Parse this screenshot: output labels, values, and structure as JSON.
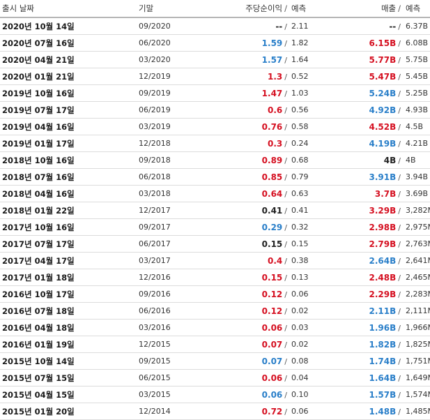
{
  "colors": {
    "positive": "#2a7fc9",
    "negative": "#d51021",
    "neutral": "#222222"
  },
  "header": {
    "date": "출시 날짜",
    "period": "기말",
    "eps": "주당순이익",
    "eps_slash": "/",
    "eps_forecast": "예측",
    "revenue": "매출",
    "revenue_slash": "/",
    "revenue_forecast": "예측"
  },
  "rows": [
    {
      "date": "2020년 10월 14일",
      "period": "09/2020",
      "eps": "--",
      "eps_dir": "neu",
      "eps_forecast": "2.11",
      "revenue": "--",
      "rev_dir": "neu",
      "revenue_forecast": "6.37B"
    },
    {
      "date": "2020년 07월 16일",
      "period": "06/2020",
      "eps": "1.59",
      "eps_dir": "pos",
      "eps_forecast": "1.82",
      "revenue": "6.15B",
      "rev_dir": "neg",
      "revenue_forecast": "6.08B"
    },
    {
      "date": "2020년 04월 21일",
      "period": "03/2020",
      "eps": "1.57",
      "eps_dir": "pos",
      "eps_forecast": "1.64",
      "revenue": "5.77B",
      "rev_dir": "neg",
      "revenue_forecast": "5.75B"
    },
    {
      "date": "2020년 01월 21일",
      "period": "12/2019",
      "eps": "1.3",
      "eps_dir": "neg",
      "eps_forecast": "0.52",
      "revenue": "5.47B",
      "rev_dir": "neg",
      "revenue_forecast": "5.45B"
    },
    {
      "date": "2019년 10월 16일",
      "period": "09/2019",
      "eps": "1.47",
      "eps_dir": "neg",
      "eps_forecast": "1.03",
      "revenue": "5.24B",
      "rev_dir": "pos",
      "revenue_forecast": "5.25B"
    },
    {
      "date": "2019년 07월 17일",
      "period": "06/2019",
      "eps": "0.6",
      "eps_dir": "neg",
      "eps_forecast": "0.56",
      "revenue": "4.92B",
      "rev_dir": "pos",
      "revenue_forecast": "4.93B"
    },
    {
      "date": "2019년 04월 16일",
      "period": "03/2019",
      "eps": "0.76",
      "eps_dir": "neg",
      "eps_forecast": "0.58",
      "revenue": "4.52B",
      "rev_dir": "neg",
      "revenue_forecast": "4.5B"
    },
    {
      "date": "2019년 01월 17일",
      "period": "12/2018",
      "eps": "0.3",
      "eps_dir": "neg",
      "eps_forecast": "0.24",
      "revenue": "4.19B",
      "rev_dir": "pos",
      "revenue_forecast": "4.21B"
    },
    {
      "date": "2018년 10월 16일",
      "period": "09/2018",
      "eps": "0.89",
      "eps_dir": "neg",
      "eps_forecast": "0.68",
      "revenue": "4B",
      "rev_dir": "neu",
      "revenue_forecast": "4B"
    },
    {
      "date": "2018년 07월 16일",
      "period": "06/2018",
      "eps": "0.85",
      "eps_dir": "neg",
      "eps_forecast": "0.79",
      "revenue": "3.91B",
      "rev_dir": "pos",
      "revenue_forecast": "3.94B"
    },
    {
      "date": "2018년 04월 16일",
      "period": "03/2018",
      "eps": "0.64",
      "eps_dir": "neg",
      "eps_forecast": "0.63",
      "revenue": "3.7B",
      "rev_dir": "neg",
      "revenue_forecast": "3.69B"
    },
    {
      "date": "2018년 01월 22일",
      "period": "12/2017",
      "eps": "0.41",
      "eps_dir": "neu",
      "eps_forecast": "0.41",
      "revenue": "3.29B",
      "rev_dir": "neg",
      "revenue_forecast": "3,282M"
    },
    {
      "date": "2017년 10월 16일",
      "period": "09/2017",
      "eps": "0.29",
      "eps_dir": "pos",
      "eps_forecast": "0.32",
      "revenue": "2.98B",
      "rev_dir": "neg",
      "revenue_forecast": "2,975M"
    },
    {
      "date": "2017년 07월 17일",
      "period": "06/2017",
      "eps": "0.15",
      "eps_dir": "neu",
      "eps_forecast": "0.15",
      "revenue": "2.79B",
      "rev_dir": "neg",
      "revenue_forecast": "2,763M"
    },
    {
      "date": "2017년 04월 17일",
      "period": "03/2017",
      "eps": "0.4",
      "eps_dir": "neg",
      "eps_forecast": "0.38",
      "revenue": "2.64B",
      "rev_dir": "pos",
      "revenue_forecast": "2,641M"
    },
    {
      "date": "2017년 01월 18일",
      "period": "12/2016",
      "eps": "0.15",
      "eps_dir": "neg",
      "eps_forecast": "0.13",
      "revenue": "2.48B",
      "rev_dir": "neg",
      "revenue_forecast": "2,465M"
    },
    {
      "date": "2016년 10월 17일",
      "period": "09/2016",
      "eps": "0.12",
      "eps_dir": "neg",
      "eps_forecast": "0.06",
      "revenue": "2.29B",
      "rev_dir": "neg",
      "revenue_forecast": "2,283M"
    },
    {
      "date": "2016년 07월 18일",
      "period": "06/2016",
      "eps": "0.12",
      "eps_dir": "neg",
      "eps_forecast": "0.02",
      "revenue": "2.11B",
      "rev_dir": "pos",
      "revenue_forecast": "2,111M"
    },
    {
      "date": "2016년 04월 18일",
      "period": "03/2016",
      "eps": "0.06",
      "eps_dir": "neg",
      "eps_forecast": "0.03",
      "revenue": "1.96B",
      "rev_dir": "pos",
      "revenue_forecast": "1,966M"
    },
    {
      "date": "2016년 01월 19일",
      "period": "12/2015",
      "eps": "0.07",
      "eps_dir": "neg",
      "eps_forecast": "0.02",
      "revenue": "1.82B",
      "rev_dir": "pos",
      "revenue_forecast": "1,825M"
    },
    {
      "date": "2015년 10월 14일",
      "period": "09/2015",
      "eps": "0.07",
      "eps_dir": "pos",
      "eps_forecast": "0.08",
      "revenue": "1.74B",
      "rev_dir": "pos",
      "revenue_forecast": "1,751M"
    },
    {
      "date": "2015년 07월 15일",
      "period": "06/2015",
      "eps": "0.06",
      "eps_dir": "neg",
      "eps_forecast": "0.04",
      "revenue": "1.64B",
      "rev_dir": "pos",
      "revenue_forecast": "1,649M"
    },
    {
      "date": "2015년 04월 15일",
      "period": "03/2015",
      "eps": "0.06",
      "eps_dir": "pos",
      "eps_forecast": "0.10",
      "revenue": "1.57B",
      "rev_dir": "pos",
      "revenue_forecast": "1,574M"
    },
    {
      "date": "2015년 01월 20일",
      "period": "12/2014",
      "eps": "0.72",
      "eps_dir": "neg",
      "eps_forecast": "0.06",
      "revenue": "1.48B",
      "rev_dir": "pos",
      "revenue_forecast": "1,485M"
    }
  ]
}
